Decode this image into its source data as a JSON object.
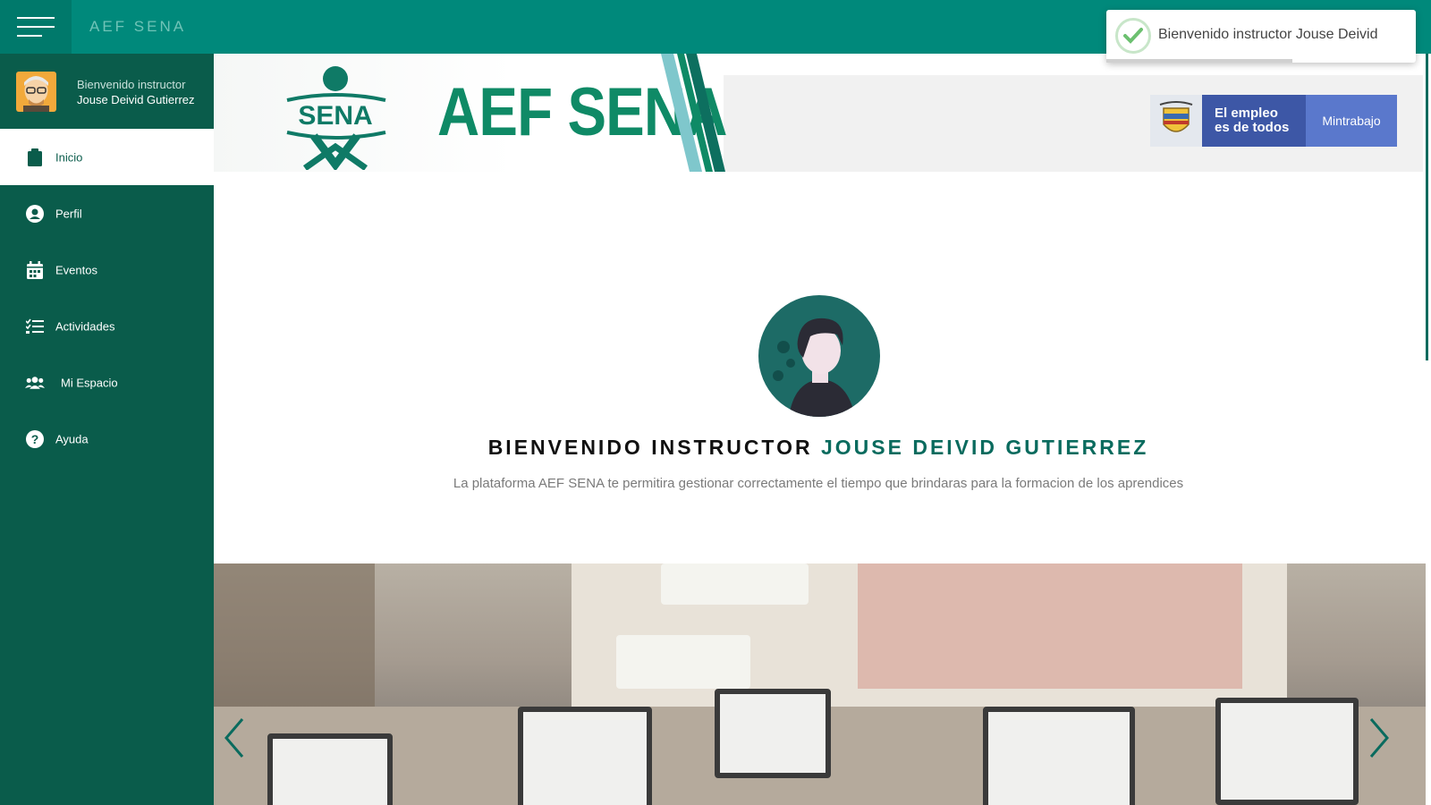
{
  "topbar": {
    "brand": "AEF SENA"
  },
  "toast": {
    "message": "Bienvenido instructor Jouse Deivid",
    "progress": 0.6
  },
  "sidebar": {
    "greeting": "Bienvenido instructor",
    "user_name": "Jouse Deivid Gutierrez",
    "items": [
      {
        "label": "Inicio",
        "icon": "clipboard-icon",
        "active": true
      },
      {
        "label": "Perfil",
        "icon": "user-circle-icon"
      },
      {
        "label": "Eventos",
        "icon": "calendar-icon"
      },
      {
        "label": "Actividades",
        "icon": "tasks-icon"
      },
      {
        "label": "Mi Espacio",
        "icon": "users-icon"
      },
      {
        "label": "Ayuda",
        "icon": "question-icon"
      }
    ]
  },
  "banner": {
    "logo_text": "SENA",
    "title": "AEF SENA",
    "gov_text_line1": "El empleo",
    "gov_text_line2": "es de todos",
    "gov_ministry": "Mintrabajo"
  },
  "hero": {
    "title_prefix": "BIENVENIDO INSTRUCTOR",
    "title_name": "JOUSE DEIVID GUTIERREZ",
    "subtitle": "La plataforma AEF SENA te permitira gestionar correctamente el tiempo que brindaras para la formacion de los aprendices"
  },
  "colors": {
    "primary": "#00897b",
    "sidebar": "#0a5c4b",
    "accent": "#0a6b5e",
    "logo_green": "#0f8a66"
  }
}
